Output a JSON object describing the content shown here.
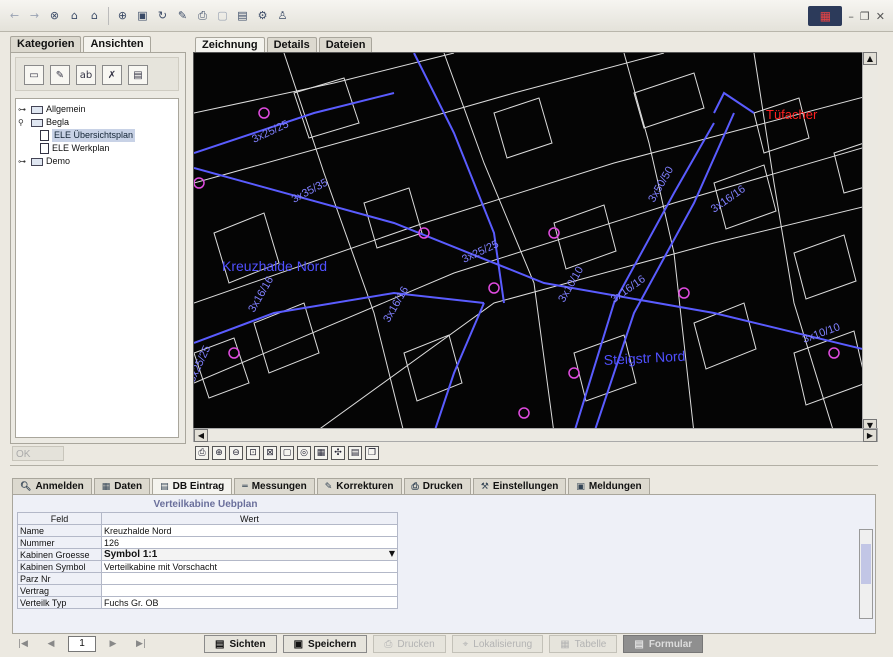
{
  "toolbar": {
    "icons": [
      "back-arrow",
      "forward-arrow",
      "stop",
      "home",
      "favorites",
      "zoom",
      "print-preview",
      "refresh",
      "edit",
      "print",
      "disabled",
      "table",
      "settings",
      "person"
    ]
  },
  "left_panel": {
    "tabs": [
      "Kategorien",
      "Ansichten"
    ],
    "tree": [
      {
        "label": "Allgemein",
        "level": 0,
        "type": "folder"
      },
      {
        "label": "Begla",
        "level": 0,
        "type": "folder"
      },
      {
        "label": "ELE Übersichtsplan",
        "level": 1,
        "type": "document",
        "selected": true
      },
      {
        "label": "ELE Werkplan",
        "level": 1,
        "type": "document"
      },
      {
        "label": "Demo",
        "level": 0,
        "type": "folder"
      }
    ],
    "ok_label": "OK"
  },
  "main_tabs": [
    "Zeichnung",
    "Details",
    "Dateien"
  ],
  "map_labels": {
    "place1": "Kreuzhalde Nord",
    "place2": "Steigstr Nord",
    "place3": "Tüfacher",
    "cables": [
      "3x25/25",
      "3x35/35",
      "3x16/16",
      "3x16/16",
      "3x25/25",
      "3x10/10",
      "3x16/16",
      "3x50/50",
      "3x16/16",
      "3x10/10",
      "3x25/25"
    ]
  },
  "bottom_tabs": [
    {
      "label": "Anmelden",
      "icon": "login-icon"
    },
    {
      "label": "Daten",
      "icon": "data-icon"
    },
    {
      "label": "DB Eintrag",
      "icon": "db-entry-icon",
      "active": true
    },
    {
      "label": "Messungen",
      "icon": "measure-icon"
    },
    {
      "label": "Korrekturen",
      "icon": "correction-icon"
    },
    {
      "label": "Drucken",
      "icon": "print-icon"
    },
    {
      "label": "Einstellungen",
      "icon": "settings-icon"
    },
    {
      "label": "Meldungen",
      "icon": "messages-icon"
    }
  ],
  "form": {
    "title": "Verteilkabine Uebplan",
    "col_field": "Feld",
    "col_value": "Wert",
    "rows": [
      {
        "field": "Name",
        "value": "Kreuzhalde Nord"
      },
      {
        "field": "Nummer",
        "value": "126"
      },
      {
        "field": "Kabinen Groesse",
        "value": "Symbol 1:1",
        "selected": true
      },
      {
        "field": "Kabinen Symbol",
        "value": "Verteilkabine mit Vorschacht"
      },
      {
        "field": "Parz Nr",
        "value": ""
      },
      {
        "field": "Vertrag",
        "value": ""
      },
      {
        "field": "Verteilk Typ",
        "value": "Fuchs Gr. OB"
      }
    ]
  },
  "footer": {
    "page": "1",
    "buttons": {
      "sichten": "Sichten",
      "speichern": "Speichern",
      "drucken": "Drucken",
      "lokalisierung": "Lokalisierung",
      "tabelle": "Tabelle",
      "formular": "Formular"
    }
  },
  "colors": {
    "map_bg": "#050505",
    "line_white": "#e8e8e8",
    "cable_blue": "#5a5cff",
    "label_red": "#ff2020",
    "label_blue": "#5050ff",
    "form_title": "#6a6f9b"
  }
}
